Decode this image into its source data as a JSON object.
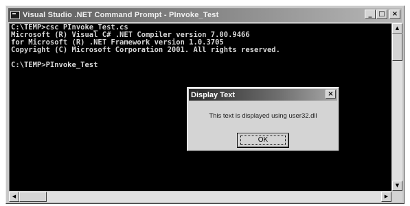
{
  "window": {
    "title": "Visual Studio .NET Command Prompt - PInvoke_Test",
    "minimize_glyph": "_",
    "maximize_glyph": "□",
    "close_glyph": "×"
  },
  "console": {
    "lines": [
      "C:\\TEMP>csc PInvoke_Test.cs",
      "Microsoft (R) Visual C# .NET Compiler version 7.00.9466",
      "for Microsoft (R) .NET Framework version 1.0.3705",
      "Copyright (C) Microsoft Corporation 2001. All rights reserved.",
      "",
      "C:\\TEMP>PInvoke_Test"
    ]
  },
  "dialog": {
    "title": "Display Text",
    "close_glyph": "×",
    "message": "This text is displayed using user32.dll",
    "ok_label": "OK"
  },
  "scrollbar": {
    "up_glyph": "▲",
    "down_glyph": "▼",
    "left_glyph": "◀",
    "right_glyph": "▶"
  }
}
